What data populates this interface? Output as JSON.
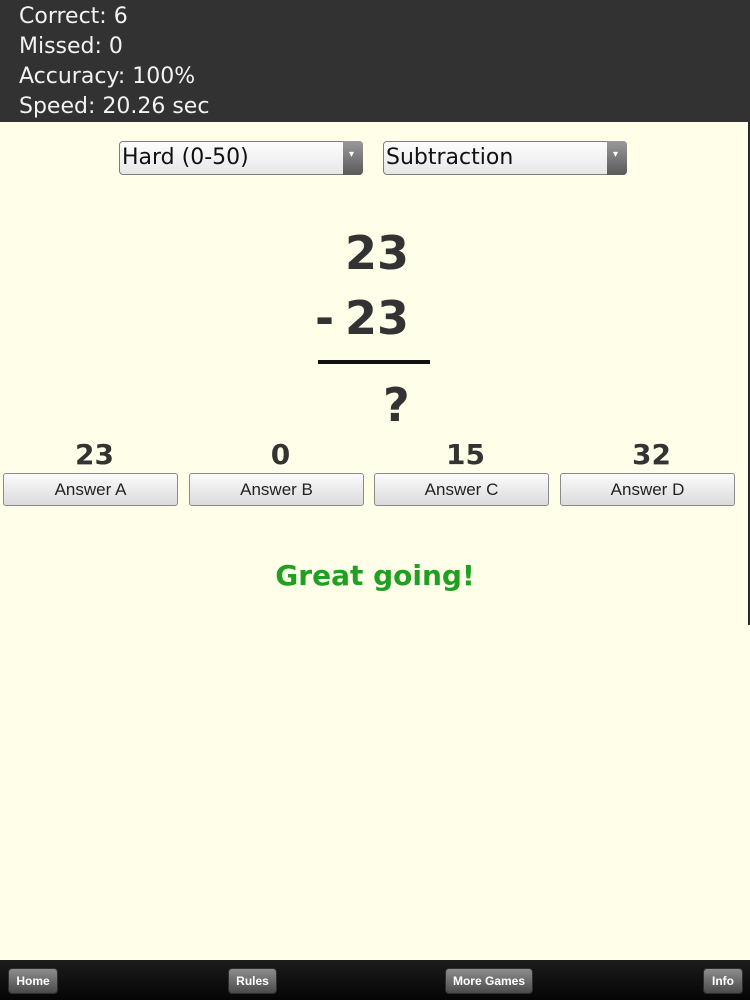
{
  "stats": {
    "correct": "Correct: 6",
    "missed": "Missed: 0",
    "accuracy": "Accuracy: 100%",
    "speed": "Speed: 20.26 sec"
  },
  "selects": {
    "difficulty": "Hard (0-50)",
    "operation": "Subtraction",
    "arrow": "▾"
  },
  "problem": {
    "top": "23",
    "operator": "-",
    "bottom": "23",
    "unknown": "?"
  },
  "answers": [
    {
      "value": "23",
      "label": "Answer A"
    },
    {
      "value": "0",
      "label": "Answer B"
    },
    {
      "value": "15",
      "label": "Answer C"
    },
    {
      "value": "32",
      "label": "Answer D"
    }
  ],
  "feedback": "Great going!",
  "nav": {
    "home": "Home",
    "rules": "Rules",
    "more_games": "More Games",
    "info": "Info"
  },
  "colors": {
    "background": "#fefee9",
    "stats_bar": "#323232",
    "feedback": "#20a020"
  }
}
